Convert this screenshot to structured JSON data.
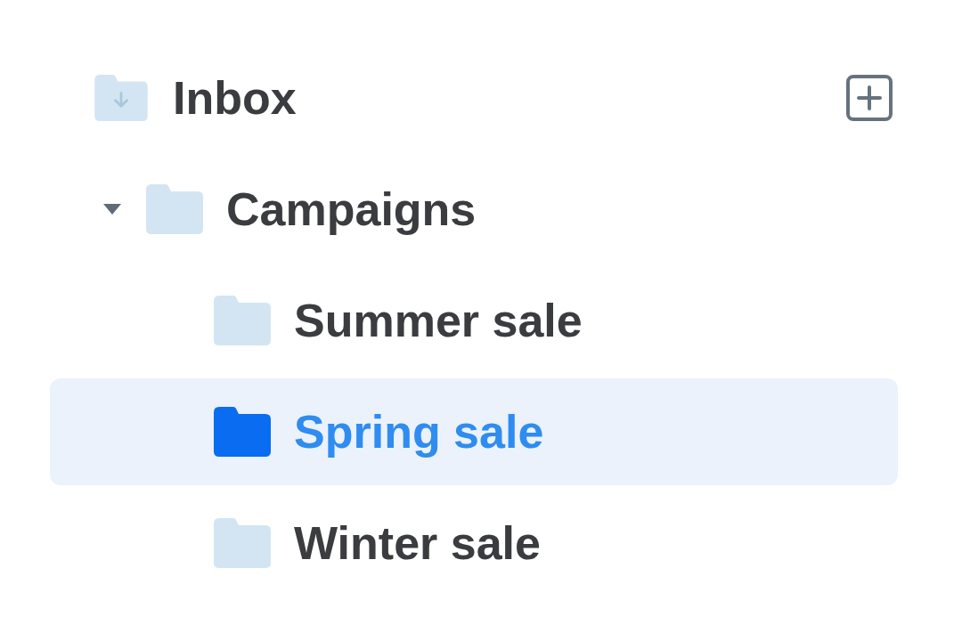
{
  "tree": [
    {
      "label": "Inbox",
      "kind": "inbox",
      "selected": false,
      "children": [
        {
          "label": "Campaigns",
          "kind": "folder",
          "selected": false,
          "expanded": true,
          "children": [
            {
              "label": "Summer sale",
              "kind": "folder",
              "selected": false
            },
            {
              "label": "Spring sale",
              "kind": "folder",
              "selected": true
            },
            {
              "label": "Winter sale",
              "kind": "folder",
              "selected": false
            }
          ]
        }
      ]
    }
  ]
}
